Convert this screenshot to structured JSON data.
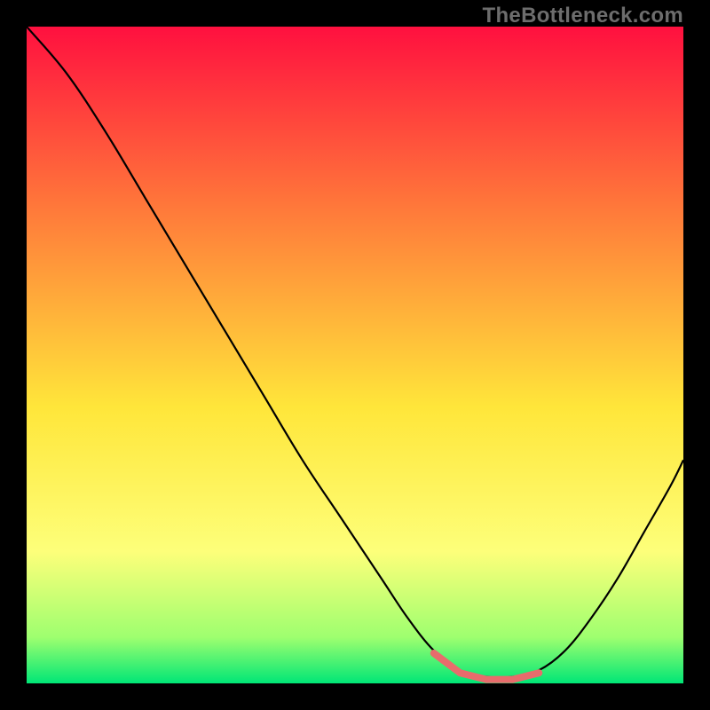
{
  "watermark": "TheBottleneck.com",
  "colors": {
    "bg_black": "#000000",
    "grad_top": "#ff103f",
    "grad_mid1": "#ff7a3a",
    "grad_mid2": "#ffe63a",
    "grad_low": "#fdff7a",
    "grad_bot1": "#9eff6f",
    "grad_bot2": "#00e676",
    "curve": "#000000",
    "pink_segment": "#e86c6c",
    "watermark": "#6d6d6d"
  },
  "chart_data": {
    "type": "line",
    "title": "",
    "xlabel": "",
    "ylabel": "",
    "x_range": [
      0,
      100
    ],
    "y_range": [
      0,
      100
    ],
    "series": [
      {
        "name": "bottleneck-curve",
        "x": [
          0,
          6,
          12,
          18,
          24,
          30,
          36,
          42,
          48,
          54,
          58,
          62,
          66,
          70,
          74,
          78,
          82,
          86,
          90,
          94,
          98,
          100
        ],
        "y": [
          100,
          93,
          84,
          74,
          64,
          54,
          44,
          34,
          25,
          16,
          10,
          5,
          2,
          1,
          1,
          2,
          5,
          10,
          16,
          23,
          30,
          34
        ]
      }
    ],
    "annotations": [
      {
        "name": "optimal-zone",
        "x_start": 62,
        "x_end": 78,
        "y_approx": 2
      }
    ]
  }
}
